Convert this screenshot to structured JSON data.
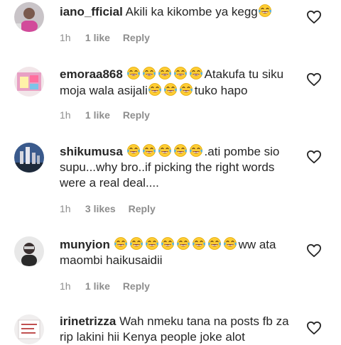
{
  "comments": [
    {
      "username": "iano_fficial",
      "segments": [
        {
          "t": "Akili ka kikombe ya kegg"
        },
        {
          "e": 1
        }
      ],
      "time": "1h",
      "likes": "1 like",
      "reply": "Reply",
      "avatar": "avatar-photo-person"
    },
    {
      "username": "emoraa868",
      "segments": [
        {
          "e": 5
        },
        {
          "t": "Atakufa tu siku moja wala asijali"
        },
        {
          "e": 3
        },
        {
          "t": "tuko hapo"
        }
      ],
      "time": "1h",
      "likes": "1 like",
      "reply": "Reply",
      "avatar": "avatar-photo-colorful"
    },
    {
      "username": "shikumusa",
      "segments": [
        {
          "e": 5
        },
        {
          "t": ".ati pombe sio supu...why bro..if picking the right words were a real deal...."
        }
      ],
      "time": "1h",
      "likes": "3 likes",
      "reply": "Reply",
      "avatar": "avatar-photo-city"
    },
    {
      "username": "munyion",
      "segments": [
        {
          "e": 8
        },
        {
          "t": "ww ata maombi haikusaidii"
        }
      ],
      "time": "1h",
      "likes": "1 like",
      "reply": "Reply",
      "avatar": "avatar-photo-person-dark"
    },
    {
      "username": "irinetrizza",
      "segments": [
        {
          "t": "Wah nmeku tana na posts fb za rip lakini hii Kenya people joke alot"
        }
      ],
      "time": "",
      "likes": "",
      "reply": "",
      "avatar": "avatar-photo-light"
    }
  ],
  "icons": {
    "emoji": "face-with-tears-of-joy-icon",
    "like": "heart-outline-icon"
  }
}
